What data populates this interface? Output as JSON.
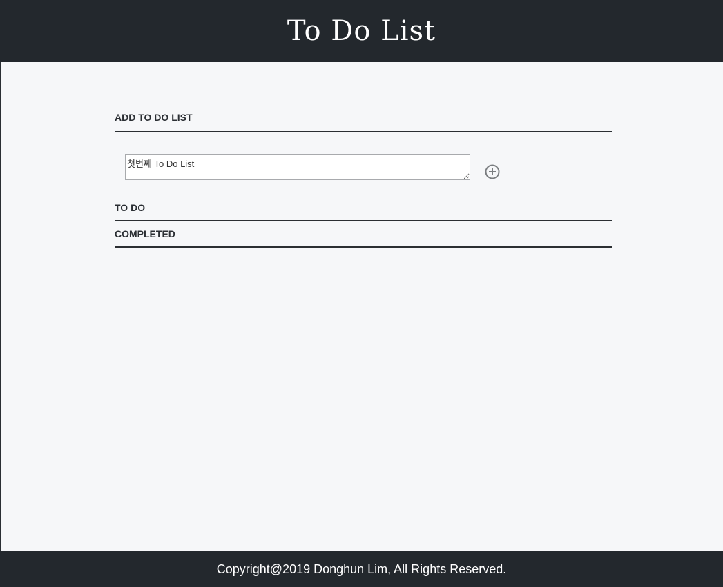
{
  "header": {
    "title": "To Do List"
  },
  "add_section": {
    "heading": "ADD TO DO LIST",
    "input_value": "첫번째 To Do List",
    "add_button_icon": "plus-circle-icon"
  },
  "todo_section": {
    "heading": "TO DO"
  },
  "completed_section": {
    "heading": "COMPLETED"
  },
  "footer": {
    "copyright": "Copyright@2019 Donghun Lim, All Rights Reserved."
  },
  "colors": {
    "header_bg": "#23282d",
    "page_bg": "#f6f7f9",
    "icon": "#7a7d80"
  }
}
